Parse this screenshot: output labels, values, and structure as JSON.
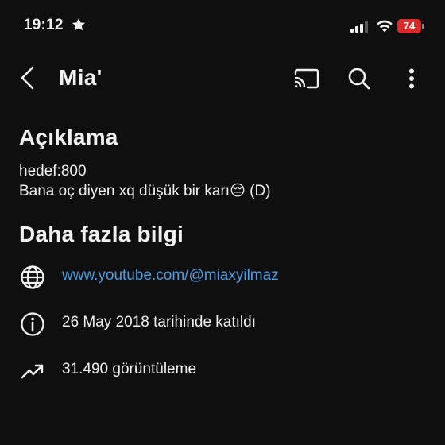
{
  "status_bar": {
    "time": "19:12",
    "battery_percent": "74",
    "battery_color": "#d92a2a",
    "icons": [
      "star-icon",
      "signal-icon",
      "wifi-icon",
      "battery-icon"
    ]
  },
  "header": {
    "title": "Mia'",
    "icons": [
      "back-arrow-icon",
      "cast-icon",
      "search-icon",
      "more-vertical-icon"
    ]
  },
  "description": {
    "heading": "Açıklama",
    "lines": [
      "hedef:800",
      "Bana oç diyen xq düşük bir karı😔 (D)"
    ]
  },
  "more_info": {
    "heading": "Daha fazla bilgi",
    "rows": [
      {
        "icon": "globe-icon",
        "text": "www.youtube.com/@miaxyilmaz",
        "link_color": "#4d9de0"
      },
      {
        "icon": "info-icon",
        "text": "26 May 2018 tarihinde katıldı"
      },
      {
        "icon": "trending-icon",
        "text": "31.490 görüntüleme"
      }
    ]
  }
}
